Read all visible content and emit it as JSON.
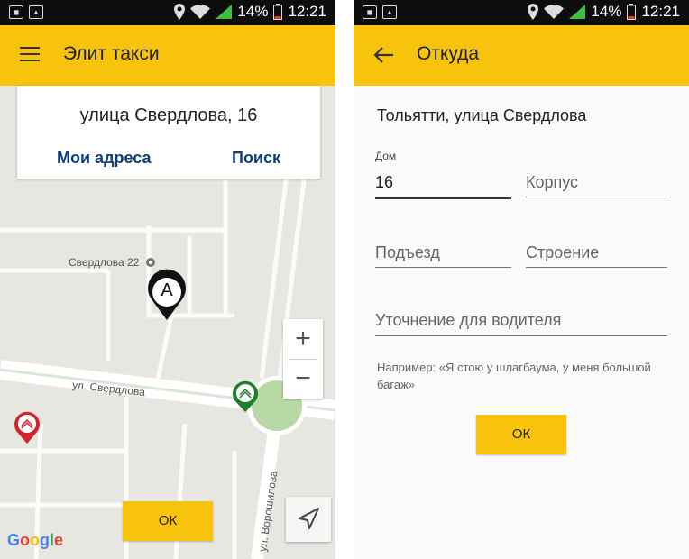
{
  "status": {
    "battery": "14%",
    "time": "12:21"
  },
  "left": {
    "title": "Элит такси",
    "address": "улица Свердлова, 16",
    "my_addresses": "Мои адреса",
    "search": "Поиск",
    "poi_label": "Свердлова 22",
    "street_label_1": "ул. Свердлова",
    "street_label_2": "ул. Ворошилова",
    "marker_letter": "A",
    "zoom_in": "+",
    "zoom_out": "−",
    "ok": "ОК",
    "google": "Google"
  },
  "right": {
    "title": "Откуда",
    "city": "Тольятти, улица Свердлова",
    "house_label": "Дом",
    "house_value": "16",
    "building_placeholder": "Корпус",
    "entrance_placeholder": "Подъезд",
    "structure_placeholder": "Строение",
    "note_placeholder": "Уточнение для водителя",
    "hint": "Например: «Я стою у шлагбаума, у меня большой багаж»",
    "ok": "ОК"
  },
  "colors": {
    "accent": "#f8c30d",
    "link": "#0f3f7f",
    "taxi_green": "#1d7f2a",
    "taxi_red": "#d3232b"
  }
}
